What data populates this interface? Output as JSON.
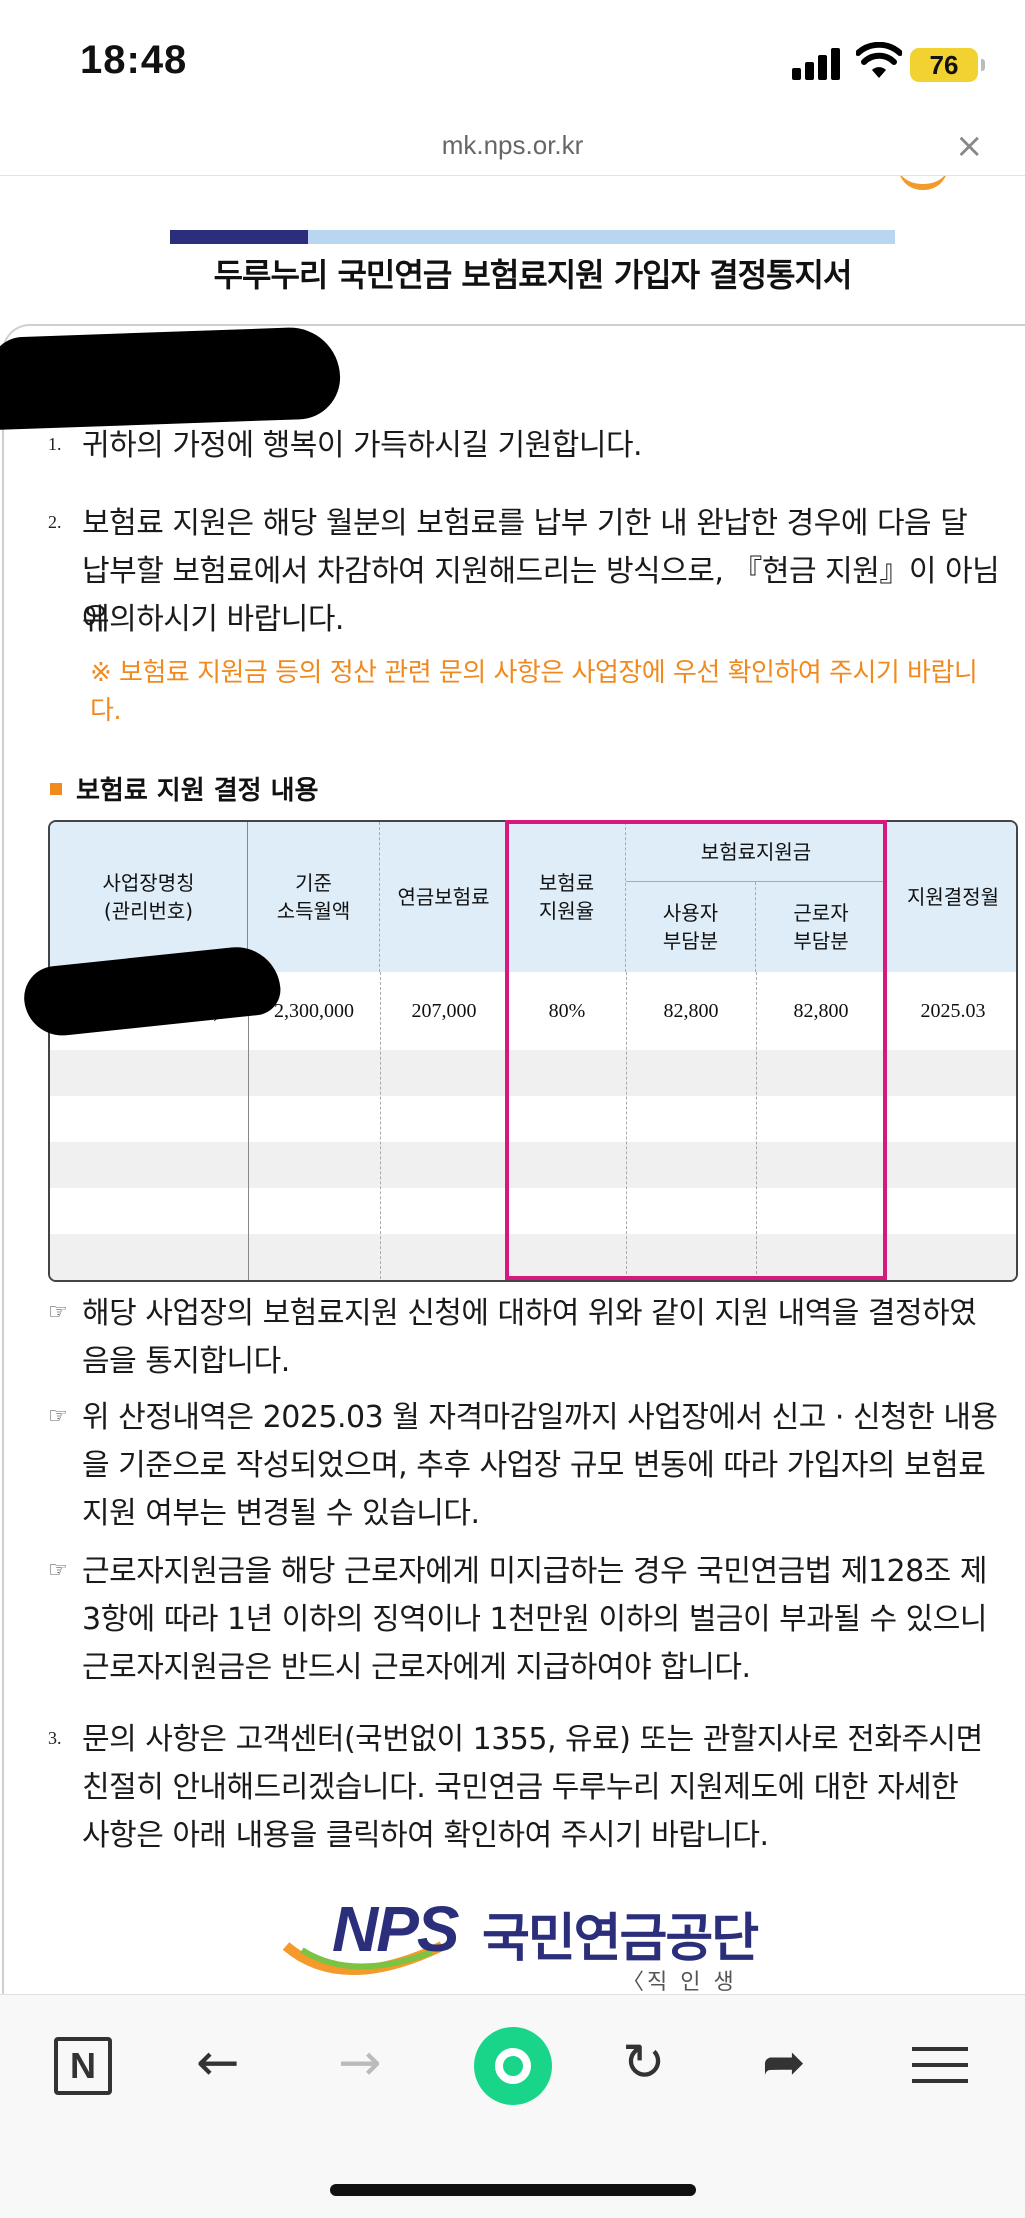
{
  "status": {
    "time": "18:48",
    "battery": "76"
  },
  "browser": {
    "url": "mk.nps.or.kr",
    "close_glyph": "×"
  },
  "doc": {
    "title": "두루누리 국민연금 보험료지원 가입자 결정통지서",
    "p1_num": "1.",
    "p1_text": "귀하의 가정에 행복이 가득하시길 기원합니다.",
    "p2_num": "2.",
    "p2_line1": "보험료 지원은 해당 월분의 보험료를 납부 기한 내 완납한 경우에 다음 달",
    "p2_line2": "납부할 보험료에서 차감하여 지원해드리는 방식으로, 『현금 지원』이 아님에",
    "p2_line3": "유의하시기 바랍니다.",
    "note_line1": "※ 보험료 지원금 등의 정산 관련 문의 사항은 사업장에 우선 확인하여 주시기 바랍니",
    "note_line2": "다.",
    "section_title": "보험료 지원 결정 내용",
    "table": {
      "h_company1": "사업장명칭",
      "h_company2": "(관리번호)",
      "h_income1": "기준",
      "h_income2": "소득월액",
      "h_annual": "연금보험료",
      "h_rate1": "보험료",
      "h_rate2": "지원율",
      "h_support": "보험료지원금",
      "h_employer1": "사용자",
      "h_employer2": "부담분",
      "h_worker1": "근로자",
      "h_worker2": "부담분",
      "h_month": "지원결정월",
      "row_company_tail": ")",
      "row_income": "2,300,000",
      "row_annual": "207,000",
      "row_rate": "80%",
      "row_employer": "82,800",
      "row_worker": "82,800",
      "row_month": "2025.03"
    },
    "b1_line1": "해당 사업장의 보험료지원 신청에 대하여 위와 같이 지원 내역을 결정하였",
    "b1_line2": "음을 통지합니다.",
    "b2_line1": "위 산정내역은 2025.03 월 자격마감일까지 사업장에서 신고 · 신청한 내용",
    "b2_line2": "을 기준으로 작성되었으며, 추후 사업장 규모 변동에 따라 가입자의 보험료",
    "b2_line3": "지원 여부는 변경될 수 있습니다.",
    "b3_line1": "근로자지원금을 해당 근로자에게 미지급하는 경우 국민연금법 제128조 제",
    "b3_line2": "3항에 따라 1년 이하의 징역이나 1천만원 이하의 벌금이 부과될 수 있으니",
    "b3_line3": "근로자지원금은 반드시 근로자에게 지급하여야 합니다.",
    "bullet_glyph": "☞",
    "p3_num": "3.",
    "p3_line1": "문의 사항은 고객센터(국번없이 1355, 유료) 또는 관할지사로 전화주시면",
    "p3_line2": "친절히 안내해드리겠습니다. 국민연금 두루누리 지원제도에 대한 자세한",
    "p3_line3": "사항은 아래 내용을 클릭하여 확인하여 주시기 바랍니다.",
    "logo_mark": "NPS",
    "logo_name": "국민연금공단",
    "logo_sub": "〈직 인 생 략〉"
  },
  "toolbar": {
    "n_label": "N",
    "back_glyph": "←",
    "forward_glyph": "→",
    "reload_glyph": "↻",
    "share_glyph": "➦"
  },
  "colors": {
    "accent_pink": "#d6197c",
    "note_orange": "#f08a1f",
    "header_blue": "#deedf8",
    "brand_navy": "#2b2e7a",
    "naver_green": "#19d58a"
  }
}
